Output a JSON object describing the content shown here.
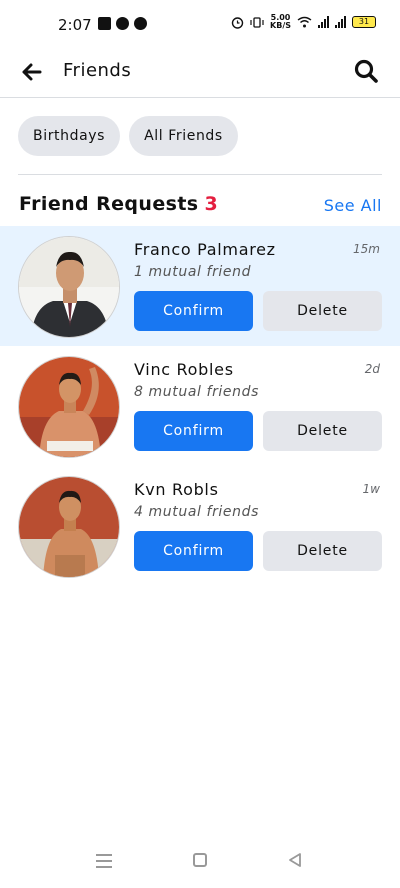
{
  "status_bar": {
    "time": "2:07",
    "speed_value": "5.00",
    "speed_unit": "KB/S",
    "battery": "31"
  },
  "header": {
    "title": "Friends",
    "back_icon": "arrow-left-icon",
    "search_icon": "search-icon"
  },
  "chips": [
    "Birthdays",
    "All Friends"
  ],
  "section": {
    "title": "Friend Requests",
    "count": "3",
    "see_all": "See All"
  },
  "requests": [
    {
      "name": "Franco Palmarez",
      "mutual": "1 mutual friend",
      "time": "15m",
      "confirm": "Confirm",
      "delete": "Delete"
    },
    {
      "name": "Vinc Robles",
      "mutual": "8 mutual friends",
      "time": "2d",
      "confirm": "Confirm",
      "delete": "Delete"
    },
    {
      "name": "Kvn Robls",
      "mutual": "4 mutual friends",
      "time": "1w",
      "confirm": "Confirm",
      "delete": "Delete"
    }
  ],
  "colors": {
    "accent": "#1877f2",
    "count": "#e41e3f",
    "highlight": "#e7f3ff",
    "chip": "#e4e6eb"
  }
}
